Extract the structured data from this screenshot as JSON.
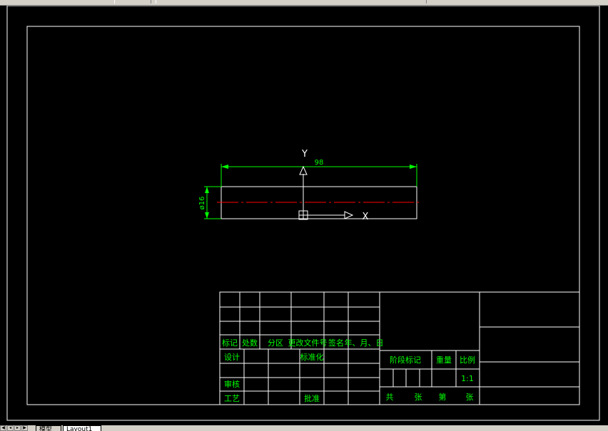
{
  "colors": {
    "background": "#000000",
    "frame": "#ffffff",
    "dimension": "#00ff00",
    "centerline": "#ff0000",
    "table_text": "#00ff00",
    "ui_gray": "#d4d0c8"
  },
  "drawing": {
    "dim_length": "98",
    "dim_diameter": "ø16",
    "ucs_x": "X",
    "ucs_y": "Y"
  },
  "title_block": {
    "header": {
      "mark": "标记",
      "count": "处数",
      "zone": "分区",
      "doc_no": "更改文件号",
      "sign": "签名",
      "date": "年、月、日"
    },
    "design": "设计",
    "standardize": "标准化",
    "stage_mark": "阶段标记",
    "weight": "重量",
    "scale_label": "比例",
    "scale_value": "1:1",
    "review": "审核",
    "process": "工艺",
    "approve": "批准",
    "total": "共",
    "sheets": "张",
    "page": "第",
    "sheet2": "张"
  },
  "tabs": {
    "model": "模型",
    "layout1": "Layout1"
  },
  "icons": {
    "first": "first-icon",
    "prev": "prev-icon",
    "next": "next-icon",
    "last": "last-icon"
  }
}
